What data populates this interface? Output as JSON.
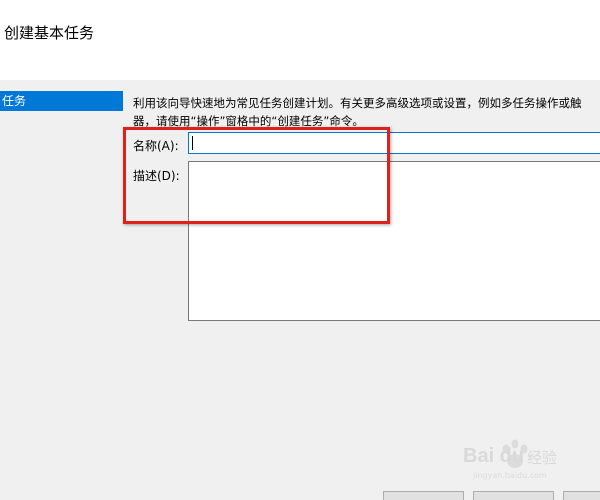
{
  "window": {
    "title": "创建基本任务"
  },
  "sidebar": {
    "items": [
      {
        "label": "任务",
        "selected": true
      }
    ]
  },
  "content": {
    "intro_lines": [
      "利用该向导快速地为常见任务创建计划。有关更多高级选项或设置，例如多任务操作或触",
      "器，请使用“操作”窗格中的“创建任务”命令。"
    ],
    "name_field": {
      "label": "名称(A):",
      "value": ""
    },
    "description_field": {
      "label": "描述(D):",
      "value": ""
    }
  },
  "annotation": {
    "color": "#e0201b"
  },
  "watermark": {
    "brand": "Bai du",
    "sub": "经验",
    "url": "jingyan.baidu.com"
  },
  "colors": {
    "accent": "#0078d7",
    "panel_bg": "#f0f0f0"
  }
}
